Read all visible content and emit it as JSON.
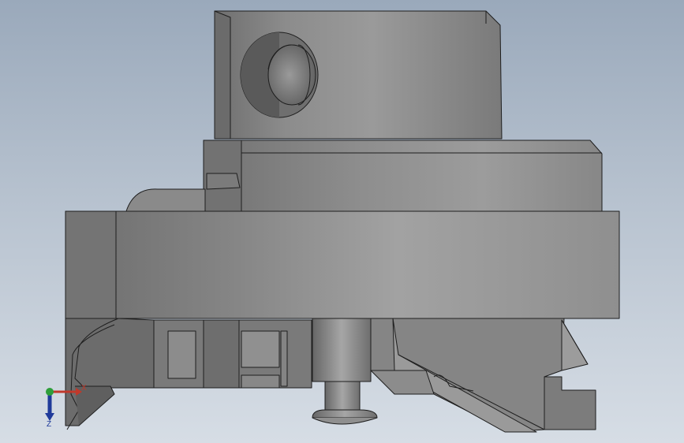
{
  "viewport": {
    "background_top": "#9aa9bb",
    "background_bottom": "#d6dde5",
    "part_color": "#8a8a8a",
    "edge_color": "#1e1e1e"
  },
  "triad": {
    "x_label": "X",
    "z_label": "Z",
    "x_color": "#c0392b",
    "y_color": "#2e9e3a",
    "z_color": "#1f3a9a"
  }
}
